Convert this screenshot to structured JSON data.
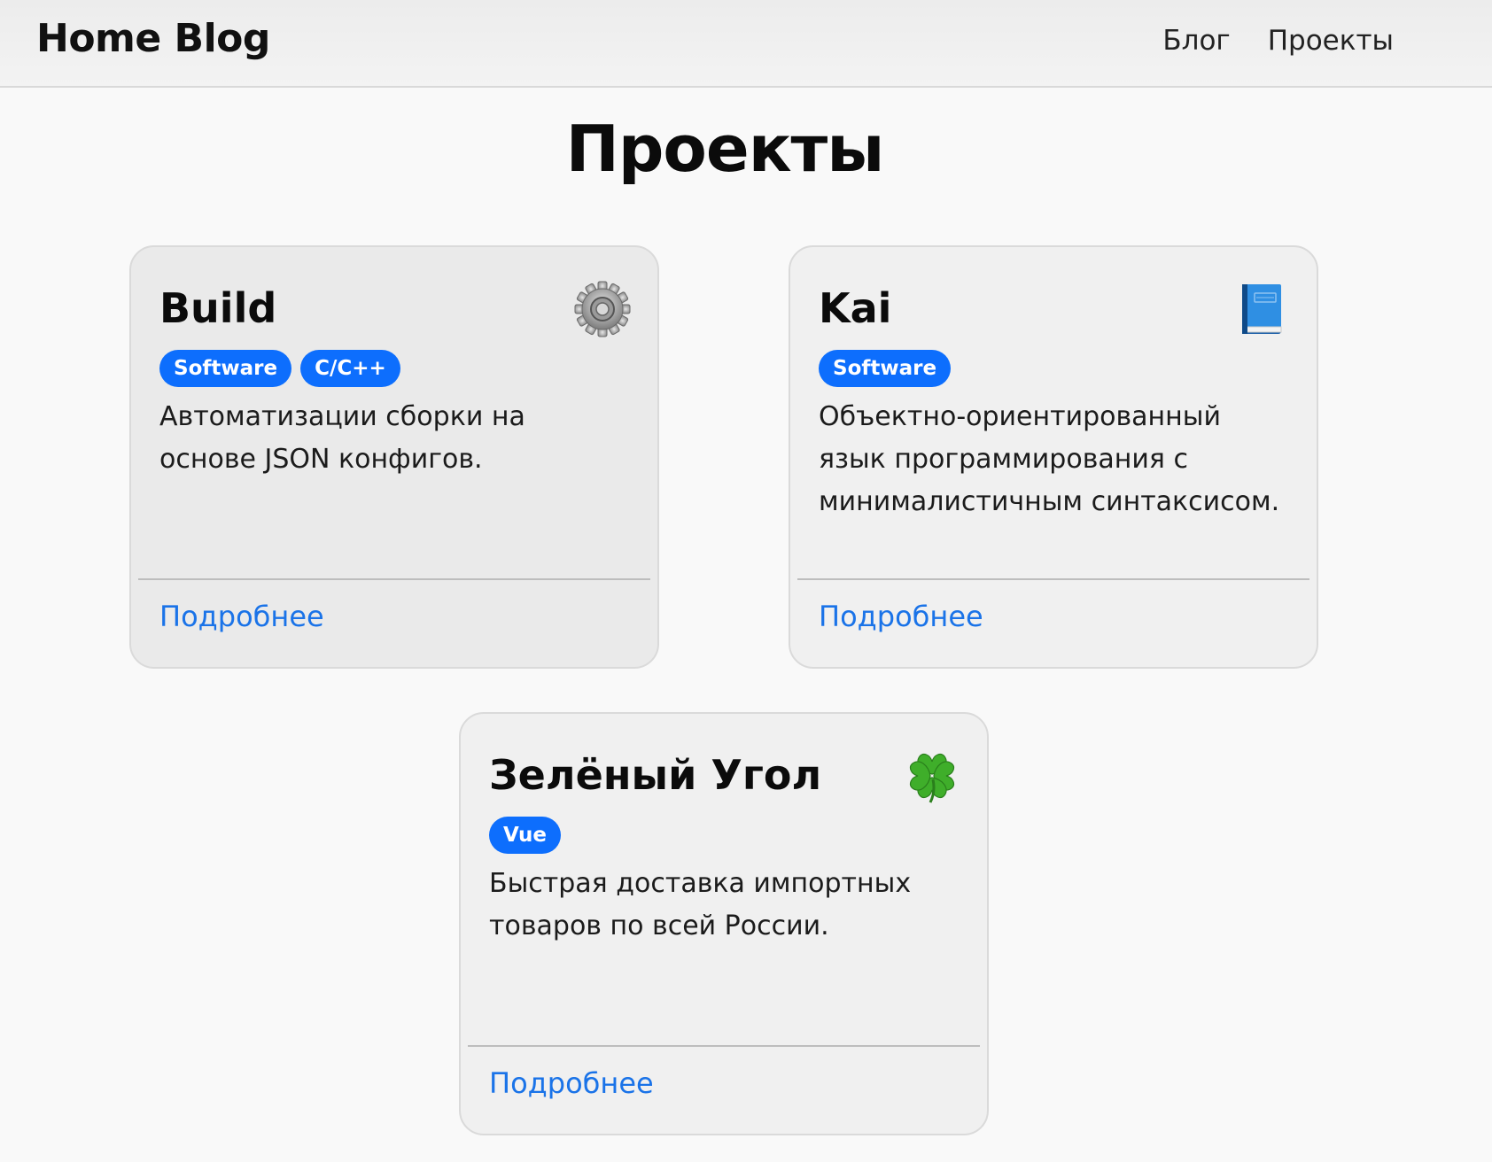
{
  "nav": {
    "brand": "Home Blog",
    "links": [
      "Блог",
      "Проекты"
    ]
  },
  "page": {
    "title": "Проекты"
  },
  "projects": [
    {
      "title": "Build",
      "icon": "gear-icon",
      "tags": [
        "Software",
        "C/C++"
      ],
      "description": "Автоматизации сборки на основе JSON конфигов.",
      "link": "Подробнее"
    },
    {
      "title": "Kai",
      "icon": "blue-book-icon",
      "tags": [
        "Software"
      ],
      "description": "Объектно-ориентированный язык программирования с минималистичным синтаксисом.",
      "link": "Подробнее"
    },
    {
      "title": "Зелёный Угол",
      "icon": "four-leaf-clover-icon",
      "tags": [
        "Vue"
      ],
      "description": "Быстрая доставка импортных товаров по всей России.",
      "link": "Подробнее"
    }
  ],
  "colors": {
    "tag_background": "#0d6efd",
    "link": "#1a73e8",
    "page_background": "#f9f9f9"
  }
}
